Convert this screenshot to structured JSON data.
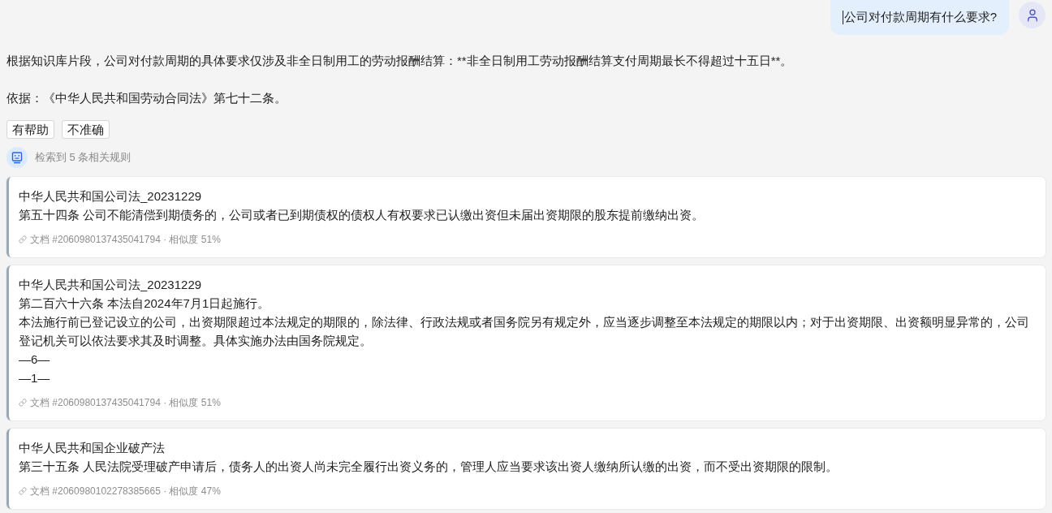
{
  "user_message": {
    "text": "公司对付款周期有什么要求?"
  },
  "answer": {
    "paragraphs": [
      "根据知识库片段，公司对付款周期的具体要求仅涉及非全日制用工的劳动报酬结算：**非全日制用工劳动报酬结算支付周期最长不得超过十五日**。",
      "依据：《中华人民共和国劳动合同法》第七十二条。"
    ]
  },
  "feedback_buttons": [
    {
      "label": "有帮助"
    },
    {
      "label": "不准确"
    }
  ],
  "retrieval_summary": {
    "text": "检索到 5 条相关规则"
  },
  "references": [
    {
      "title": "中华人民共和国公司法_20231229",
      "lines": [
        "第五十四条 公司不能清偿到期债务的，公司或者已到期债权的债权人有权要求已认缴出资但未届出资期限的股东提前缴纳出资。"
      ],
      "meta": "文档 #2060980137435041794 · 相似度 51%"
    },
    {
      "title": "中华人民共和国公司法_20231229",
      "lines": [
        "第二百六十六条 本法自2024年7月1日起施行。",
        "本法施行前已登记设立的公司，出资期限超过本法规定的期限的，除法律、行政法规或者国务院另有规定外，应当逐步调整至本法规定的期限以内；对于出资期限、出资额明显异常的，公司登记机关可以依法要求其及时调整。具体实施办法由国务院规定。",
        "—6—",
        "—1—"
      ],
      "meta": "文档 #2060980137435041794 · 相似度 51%"
    },
    {
      "title": "中华人民共和国企业破产法",
      "lines": [
        "第三十五条 人民法院受理破产申请后，债务人的出资人尚未完全履行出资义务的，管理人应当要求该出资人缴纳所认缴的出资，而不受出资期限的限制。"
      ],
      "meta": "文档 #2060980102278385665 · 相似度 47%"
    }
  ]
}
